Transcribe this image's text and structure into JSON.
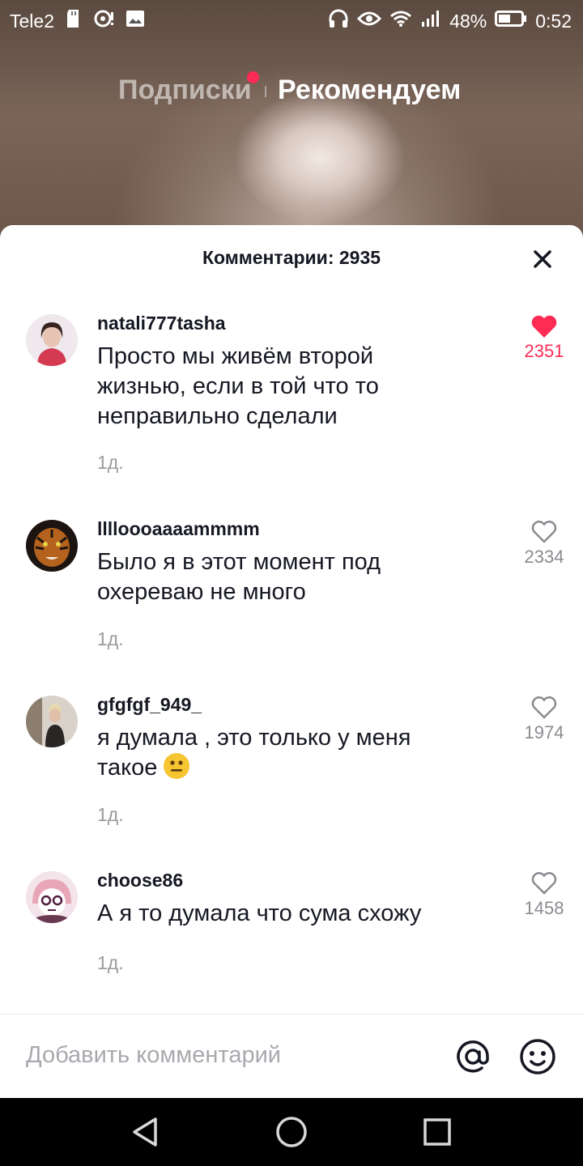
{
  "status_bar": {
    "carrier": "Tele2",
    "battery": "48%",
    "time": "0:52",
    "icons": [
      "sd-card-icon",
      "hotspot-icon",
      "image-icon",
      "headphones-icon",
      "eye-icon",
      "wifi-icon",
      "signal-icon",
      "battery-icon"
    ]
  },
  "feed_tabs": {
    "following": "Подписки",
    "for_you": "Рекомендуем"
  },
  "comments_sheet": {
    "title": "Комментарии: 2935",
    "comments": [
      {
        "username": "natali777tasha",
        "text": "Просто мы живём второй жизнью, если в той что то неправильно сделали",
        "time": "1д.",
        "likes": "2351",
        "liked": true
      },
      {
        "username": "lllloooaaaammmm",
        "text": "Было я в этот момент под охереваю не много",
        "time": "1д.",
        "likes": "2334",
        "liked": false
      },
      {
        "username": "gfgfgf_949_",
        "text": "я думала , это только у меня такое",
        "emoji": "neutral-face-emoji",
        "time": "1д.",
        "likes": "1974",
        "liked": false
      },
      {
        "username": "choose86",
        "text": "А я то думала что сума схожу",
        "time": "1д.",
        "likes": "1458",
        "liked": false
      }
    ]
  },
  "input_bar": {
    "placeholder": "Добавить комментарий"
  },
  "colors": {
    "accent": "#fe2c55",
    "text": "#161823",
    "muted": "#9a9aa0"
  }
}
